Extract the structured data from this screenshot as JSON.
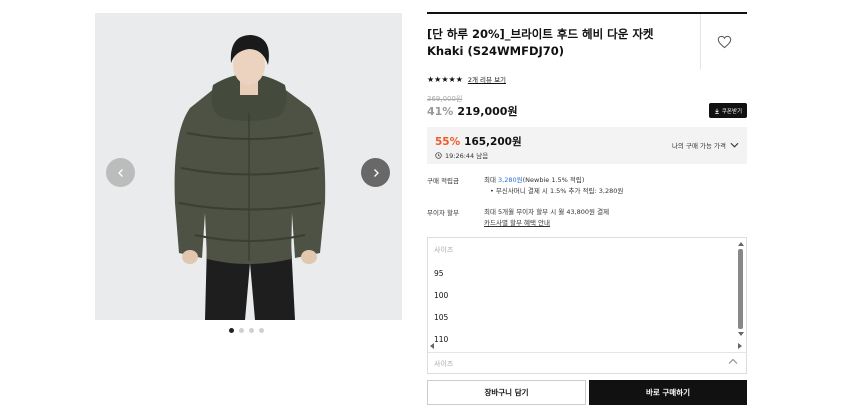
{
  "product": {
    "title": "[단 하루 20%]_브라이트 후드 헤비 다운 자켓 Khaki (S24WMFDJ70)",
    "stars": "★★★★★",
    "review_link": "2개 리뷰 보기",
    "rating": 5
  },
  "pricing": {
    "original_price": "369,000원",
    "discount": "41%",
    "price": "219,000원",
    "coupon_label": "쿠폰받기",
    "my_discount": "55%",
    "my_price": "165,200원",
    "timer": "19:26:44 남음",
    "my_price_toggle": "나의 구매 가능 가격"
  },
  "benefits": {
    "points_label": "구매 적립금",
    "points_prefix": "최대 ",
    "points_value": "3,280원",
    "points_suffix": "(Newbie 1.5% 적립)",
    "points_sub": "• 무신사머니 결제 시 1.5% 추가 적립: 3,280원",
    "installment_label": "무이자 할부",
    "installment_text": "최대 5개월 무이자 할부 시 월 43,800원 결제",
    "installment_link": "카드사별 할부 혜택 안내"
  },
  "size_select": {
    "header": "사이즈",
    "options": [
      "95",
      "100",
      "105",
      "110"
    ],
    "footer_placeholder": "사이즈"
  },
  "gallery": {
    "dot_count": 4,
    "active_index": 0
  },
  "actions": {
    "cart_label": "장바구니 담기",
    "buy_label": "바로 구매하기"
  },
  "colors": {
    "accent_discount": "#f05a28",
    "points_blue": "#2b6fd6",
    "primary_button": "#111111"
  }
}
